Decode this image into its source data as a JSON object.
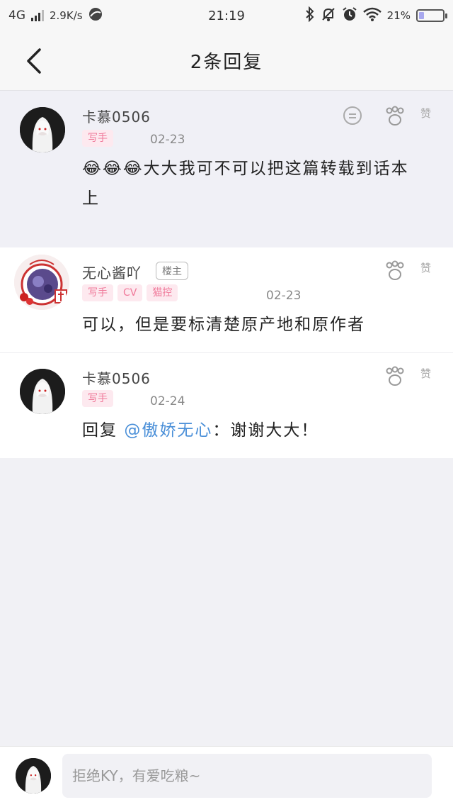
{
  "status_bar": {
    "network": "4G",
    "speed": "2.9K/s",
    "time": "21:19",
    "battery": "21%",
    "battery_level": 0.21
  },
  "header": {
    "title": "2条回复"
  },
  "comments": [
    {
      "username": "卡慕0506",
      "tags": [
        "写手"
      ],
      "date": "02-23",
      "content": "😂😂😂大大我可不可以把这篇转载到话本上",
      "like_label": "赞"
    },
    {
      "username": "无心酱吖",
      "owner_badge": "楼主",
      "tags": [
        "写手",
        "CV",
        "猫控"
      ],
      "date": "02-23",
      "content": "可以，但是要标清楚原产地和原作者",
      "like_label": "赞"
    },
    {
      "username": "卡慕0506",
      "tags": [
        "写手"
      ],
      "date": "02-24",
      "reply_prefix": "回复",
      "mention": "@傲娇无心",
      "reply_text": "：谢谢大大！",
      "like_label": "赞"
    }
  ],
  "input": {
    "placeholder": "拒绝KY，有爱吃粮~"
  },
  "colors": {
    "tag_bg": "#fde9ef",
    "tag_text": "#f0799a",
    "mention": "#4a8fd8"
  }
}
